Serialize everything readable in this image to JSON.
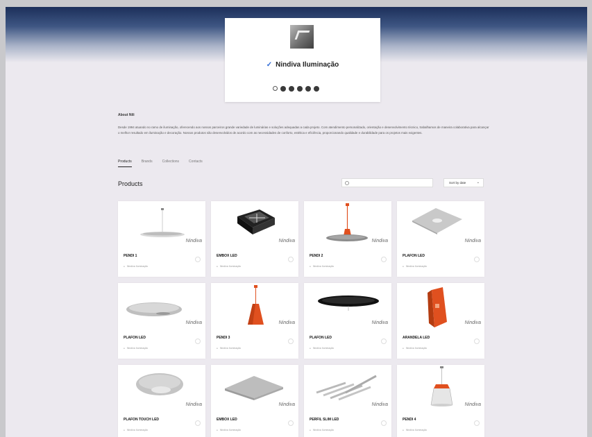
{
  "brand": {
    "name": "Nindiva Iluminação",
    "verified_icon": "check-icon",
    "logo_icon": "brand-logo-icon",
    "social_icons": [
      "website-icon",
      "facebook-icon",
      "instagram-icon",
      "linkedin-icon",
      "pinterest-icon",
      "youtube-icon"
    ]
  },
  "about": {
    "title": "About Nili",
    "text": "Desde 1994 atuando no ramo de iluminação, oferecendo aos nossos parceiros grande variedade de luminárias e soluções adequadas a cada projeto. Com atendimento personalizado, orientação e desenvolvimento técnico, trabalhamos de maneira colaborativa para alcançar o melhor resultado em iluminação e decoração. Nossos produtos são desenvolvidos de acordo com as necessidades de conforto, estética e eficiência, proporcionando qualidade e durabilidade para os projetos mais exigentes."
  },
  "tabs": [
    {
      "label": "Products",
      "active": true
    },
    {
      "label": "Brands",
      "active": false
    },
    {
      "label": "Collections",
      "active": false
    },
    {
      "label": "Contacts",
      "active": false
    }
  ],
  "products": {
    "title": "Products",
    "search_placeholder": "Search",
    "sort_label": "Sort by date",
    "watermark": "Nindiva",
    "items": [
      {
        "name": "PENDI 1",
        "meta": "Nindiva Iluminação"
      },
      {
        "name": "EMBOX LED",
        "meta": "Nindiva Iluminação"
      },
      {
        "name": "PENDI 2",
        "meta": "Nindiva Iluminação"
      },
      {
        "name": "PLAFON LED",
        "meta": "Nindiva Iluminação"
      },
      {
        "name": "PLAFON LED",
        "meta": "Nindiva Iluminação"
      },
      {
        "name": "PENDI 3",
        "meta": "Nindiva Iluminação"
      },
      {
        "name": "PLAFON LED",
        "meta": "Nindiva Iluminação"
      },
      {
        "name": "ARANDELA LED",
        "meta": "Nindiva Iluminação"
      },
      {
        "name": "PLAFON TOUCH LED",
        "meta": "Nindiva Iluminação"
      },
      {
        "name": "EMBOX LED",
        "meta": "Nindiva Iluminação"
      },
      {
        "name": "PERFIL SLIM LED",
        "meta": "Nindiva Iluminação"
      },
      {
        "name": "PENDI 4",
        "meta": "Nindiva Iluminação"
      }
    ]
  },
  "colors": {
    "banner_top": "#1c2f5a",
    "accent_orange": "#e0501f",
    "background": "#ece9ef"
  }
}
